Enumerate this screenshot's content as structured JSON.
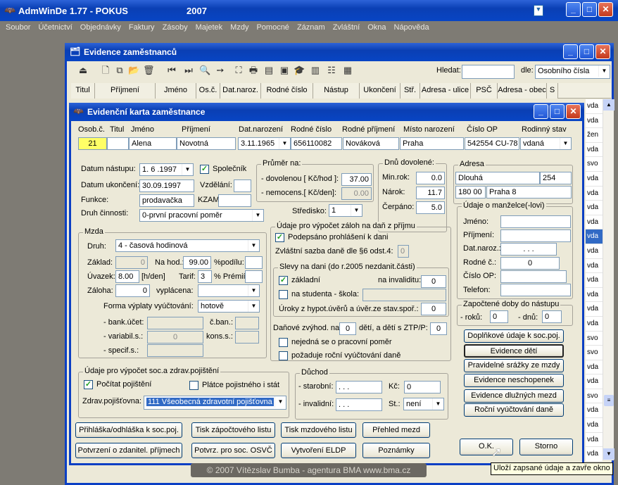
{
  "app": {
    "title": "AdmWinDe 1.77 - POKUS",
    "year": "2007"
  },
  "menu": [
    "Soubor",
    "Účetnictví",
    "Objednávky",
    "Faktury",
    "Zásoby",
    "Majetek",
    "Mzdy",
    "Pomocné",
    "Záznam",
    "Zvláštní",
    "Okna",
    "Nápověda"
  ],
  "evidence": {
    "title": "Evidence zaměstnanců",
    "search_label": "Hledat:",
    "search_value": "",
    "by_label": "dle:",
    "by_value": "Osobního čísla",
    "columns": [
      "Titul",
      "Příjmení",
      "Jméno",
      "Os.č.",
      "Dat.naroz.",
      "Rodné číslo",
      "Nástup",
      "Ukončení",
      "Stř.",
      "Adresa - ulice",
      "PSČ",
      "Adresa - obec",
      "S"
    ],
    "right_column": [
      "vda",
      "vda",
      "žen",
      "vda",
      "svo",
      "vda",
      "vda",
      "vda",
      "vda",
      "vda",
      "vda",
      "vda",
      "vda",
      "vda",
      "vda",
      "vda",
      "svo",
      "svo",
      "vda",
      "vda",
      "svo",
      "vda",
      "vda",
      "vda",
      "vda"
    ]
  },
  "karta": {
    "title": "Evidenční karta zaměstnance",
    "headers": {
      "osob": "Osob.č.",
      "titul": "Titul",
      "jmeno": "Jméno",
      "prijmeni": "Příjmení",
      "narozeni": "Dat.narození",
      "rodne": "Rodné číslo",
      "rodne_prijmeni": "Rodné příjmení",
      "misto": "Místo narození",
      "op": "Číslo OP",
      "stav": "Rodinný stav"
    },
    "values": {
      "osob": "21",
      "titul": "",
      "jmeno": "Alena",
      "prijmeni": "Novotná",
      "narozeni": "3.11.1965",
      "rodne": "656110082",
      "rodne_prijmeni": "Nováková",
      "misto": "Praha",
      "op": "542554 CU-78",
      "stav": "vdaná"
    },
    "nastup_label": "Datum nástupu:",
    "nastup": "1. 6 .1997",
    "spolecnik": "Společník",
    "ukonceni_label": "Datum ukončení:",
    "ukonceni": "30.09.1997",
    "vzdelani_label": "Vzdělání:",
    "vzdelani": "",
    "funkce_label": "Funkce:",
    "funkce": "prodavačka",
    "kzam_label": "KZAM",
    "kzam": "",
    "druh_label": "Druh činnosti:",
    "druh": "0-první pracovní poměr",
    "prumer_title": "Průměr na:",
    "dovolenou_label": "- dovolenou [ Kč/hod ]:",
    "dovolenou": "37.00",
    "nemocens_label": "- nemocens.[ Kč/den]:",
    "nemocens": "0.00",
    "dovolene_title": "Dnů dovolené:",
    "minrok_label": "Min.rok:",
    "minrok": "0.0",
    "narok_label": "Nárok:",
    "narok": "11.7",
    "cerpano_label": "Čerpáno:",
    "cerpano": "5.0",
    "stredisko_label": "Středisko:",
    "stredisko": "1",
    "adresa_title": "Adresa",
    "ulice": "Dlouhá",
    "cislo": "254",
    "psc": "180 00",
    "obec": "Praha 8",
    "manzel_title": "Údaje o manželce(-lovi)",
    "m_jmeno": "Jméno:",
    "m_prijmeni": "Příjmení:",
    "m_naroz": "Dat.naroz.:",
    "m_naroz_val": ". . .",
    "m_rodne": "Rodné č.:",
    "m_rodne_val": "0",
    "m_op": "Číslo OP:",
    "m_telefon": "Telefon:",
    "doby_title": "Započtené doby do nástupu",
    "roku_label": "- roků:",
    "roku": "0",
    "dnu_label": "- dnů:",
    "dnu": "0",
    "mzda_title": "Mzda",
    "mzda_druh_label": "Druh:",
    "mzda_druh": "4 - časová hodinová",
    "zaklad_label": "Základ:",
    "zaklad": "0",
    "nahod_label": "Na hod.:",
    "nahod": "99.00",
    "podilu_label": "%podílu:",
    "podilu": "",
    "uvazek_label": "Úvazek:",
    "uvazek": "8.00",
    "uvazek_unit": "[h/den]",
    "tarif_label": "Tarif:",
    "tarif": "3",
    "premii_label": "% Prémií:",
    "premii": "",
    "zaloha_label": "Záloha:",
    "zaloha": "0",
    "vyplacena_label": "vyplácena:",
    "vyplacena": "",
    "forma_label": "Forma výplaty vyúčtování:",
    "forma": "hotově",
    "bank_label": "- bank.účet:",
    "cban_label": "č.ban.:",
    "variabil_label": "- variabil.s.:",
    "variabil": "0",
    "kons_label": "kons.s.:",
    "specif_label": "- specif.s.:",
    "zalohy_title": "Údaje pro výpočet záloh na daň z příjmu",
    "podepsano": "Podepsáno prohlášení k dani",
    "sazba_label": "Zvláštní sazba daně dle §6 odst.4:",
    "sazba": "0",
    "slevy_title": "Slevy na dani (do r.2005 nezdanit.části)",
    "zakladni": "základní",
    "invalidita_label": "na invaliditu:",
    "invalidita": "0",
    "studenta": "na studenta - škola:",
    "uroky_label": "Úroky z hypot.úvěrů a úvěr.ze stav.spoř.:",
    "uroky": "0",
    "zvyhod_label": "Daňové zvýhod. na",
    "zvyhod": "0",
    "deti_label": "dětí, a dětí s ZTP/P:",
    "deti": "0",
    "nejedna": "nejedná se o pracovní poměr",
    "pozaduje": "požaduje roční vyúčtování daně",
    "soc_title": "Údaje pro výpočet soc.a zdrav.pojištění",
    "pocitat": "Počítat pojištění",
    "platce": "Plátce pojistného i stát",
    "zdrav_label": "Zdrav.pojišťovna:",
    "zdrav": "111 Všeobecná zdravotní pojišťovna",
    "duchod_title": "Důchod",
    "starobni_label": "- starobní:",
    "starobni": ". . .",
    "kc_label": "Kč:",
    "kc": "0",
    "invalidni_label": "- invalidní:",
    "invalidni": ". . .",
    "st_label": "St.:",
    "st": "není",
    "buttons_right": [
      "Doplňkové údaje k soc.poj.",
      "Evidence dětí",
      "Pravidelné srážky ze mzdy",
      "Evidence neschopenek",
      "Evidence dlužných mezd",
      "Roční vyúčtování daně"
    ],
    "buttons_bottom1": [
      "Přihláška/odhláška k soc.poj.",
      "Tisk zápočtového listu",
      "Tisk mzdového listu",
      "Přehled mezd"
    ],
    "buttons_bottom2": [
      "Potvrzení o zdanitel. příjmech",
      "Potvrz. pro soc. OSVČ",
      "Vytvoření ELDP",
      "Poznámky"
    ],
    "ok": "O.K.",
    "storno": "Storno",
    "tooltip": "Uloží zapsané údaje a zavře okno"
  },
  "footer": "© 2007 Vítězslav Bumba - agentura BMA   www.bma.cz"
}
